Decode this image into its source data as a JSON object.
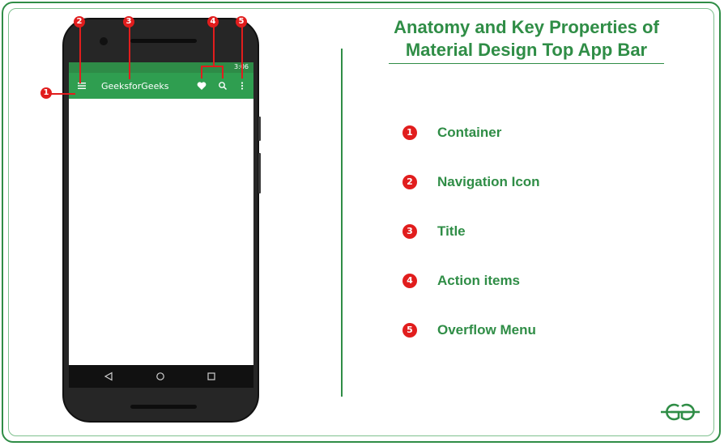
{
  "colors": {
    "brand_green": "#2f8d46",
    "appbar_green": "#2f9e50",
    "marker_red": "#e11d1d"
  },
  "heading": {
    "line1": "Anatomy and Key Properties of",
    "line2": "Material Design Top App Bar"
  },
  "phone": {
    "status_time": "3:06",
    "app_title": "GeeksforGeeks",
    "icons": [
      "menu-icon",
      "heart-icon",
      "search-icon",
      "more-vert-icon",
      "back-icon",
      "home-icon",
      "recents-icon"
    ]
  },
  "markers": [
    "1",
    "2",
    "3",
    "4",
    "5"
  ],
  "legend": [
    {
      "num": "1",
      "label": "Container"
    },
    {
      "num": "2",
      "label": "Navigation Icon"
    },
    {
      "num": "3",
      "label": "Title"
    },
    {
      "num": "4",
      "label": "Action items"
    },
    {
      "num": "5",
      "label": "Overflow Menu"
    }
  ],
  "logo": {
    "text": "GfG"
  }
}
